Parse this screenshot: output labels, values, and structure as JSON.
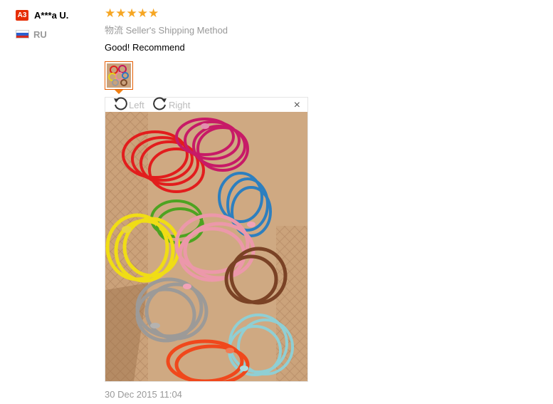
{
  "reviewer": {
    "level_badge": "A3",
    "name": "A***a U.",
    "country": "RU"
  },
  "review": {
    "rating": 5,
    "shipping_prefix": "物流",
    "shipping_method": "Seller's Shipping Method",
    "text": "Good! Recommend",
    "date": "30 Dec 2015 11:04"
  },
  "viewer": {
    "rotate_left_label": "Left",
    "rotate_right_label": "Right",
    "close_label": "×"
  },
  "colors": {
    "badge": "#e62e04",
    "star": "#f6a623",
    "thumb_border": "#e65c00"
  }
}
